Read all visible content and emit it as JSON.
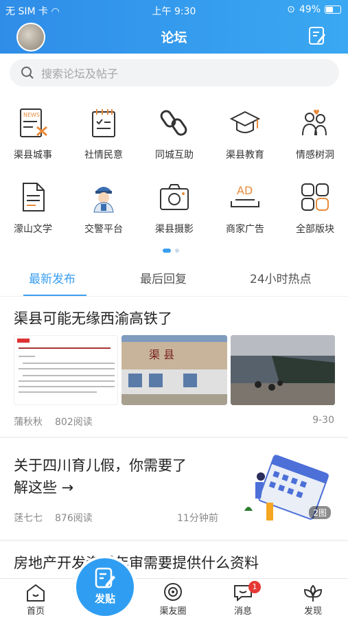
{
  "status": {
    "carrier": "无 SIM 卡",
    "time": "上午 9:30",
    "battery": "49%"
  },
  "header": {
    "title": "论坛"
  },
  "search": {
    "placeholder": "搜索论坛及帖子"
  },
  "categories": [
    {
      "label": "渠县城事",
      "icon": "news-icon"
    },
    {
      "label": "社情民意",
      "icon": "notepad-icon"
    },
    {
      "label": "同城互助",
      "icon": "chain-link-icon"
    },
    {
      "label": "渠县教育",
      "icon": "graduation-cap-icon"
    },
    {
      "label": "情感树洞",
      "icon": "people-heart-icon"
    },
    {
      "label": "濛山文学",
      "icon": "document-icon"
    },
    {
      "label": "交警平台",
      "icon": "police-officer-icon"
    },
    {
      "label": "渠县摄影",
      "icon": "camera-icon"
    },
    {
      "label": "商家广告",
      "icon": "ad-icon"
    },
    {
      "label": "全部版块",
      "icon": "grid-icon"
    }
  ],
  "tabs": [
    {
      "label": "最新发布"
    },
    {
      "label": "最后回复"
    },
    {
      "label": "24小时热点"
    }
  ],
  "posts": [
    {
      "title": "渠县可能无缘西渝高铁了",
      "author": "蒲秋秋",
      "reads": "802阅读",
      "time": "9-30",
      "station_sign": "渠 县"
    },
    {
      "title_line1": "关于四川育儿假，你需要了",
      "title_line2": "解这些 →",
      "author": "蒁七七",
      "reads": "876阅读",
      "time": "11分钟前",
      "image_count": "2图"
    },
    {
      "title": "房地产开发资质年审需要提供什么资料"
    }
  ],
  "tabbar": [
    {
      "label": "首页"
    },
    {
      "label": "发贴"
    },
    {
      "label": "渠友圈"
    },
    {
      "label": "消息",
      "badge": "1"
    },
    {
      "label": "发现"
    }
  ],
  "colors": {
    "brand": "#2f9ef2",
    "badge": "#e53935"
  }
}
